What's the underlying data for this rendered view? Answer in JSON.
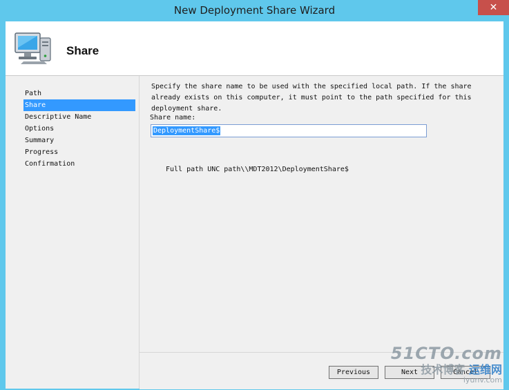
{
  "window": {
    "title": "New Deployment Share Wizard",
    "close_label": "✕"
  },
  "header": {
    "title": "Share",
    "icon": "computer-icon"
  },
  "nav": {
    "items": [
      {
        "label": "Path"
      },
      {
        "label": "Share"
      },
      {
        "label": "Descriptive Name"
      },
      {
        "label": "Options"
      },
      {
        "label": "Summary"
      },
      {
        "label": "Progress"
      },
      {
        "label": "Confirmation"
      }
    ],
    "selected_index": 1
  },
  "content": {
    "description": "Specify the share name to be used with the specified local path.  If the share already exists on this computer, it must point to the path specified for this deployment share.",
    "share_label": "Share name:",
    "share_value": "DeploymentShare$",
    "fullpath_text": "Full path UNC path\\\\MDT2012\\DeploymentShare$"
  },
  "footer": {
    "previous_label": "Previous",
    "next_label": "Next",
    "cancel_label": "Cancel"
  },
  "watermark": {
    "logo": "51CTO.com",
    "sub_left": "技术博客",
    "sub_right": "运维网",
    "site": "iyunv.com"
  },
  "colors": {
    "titlebar": "#5fc8ec",
    "selection": "#3399ff",
    "close": "#c7504b"
  }
}
